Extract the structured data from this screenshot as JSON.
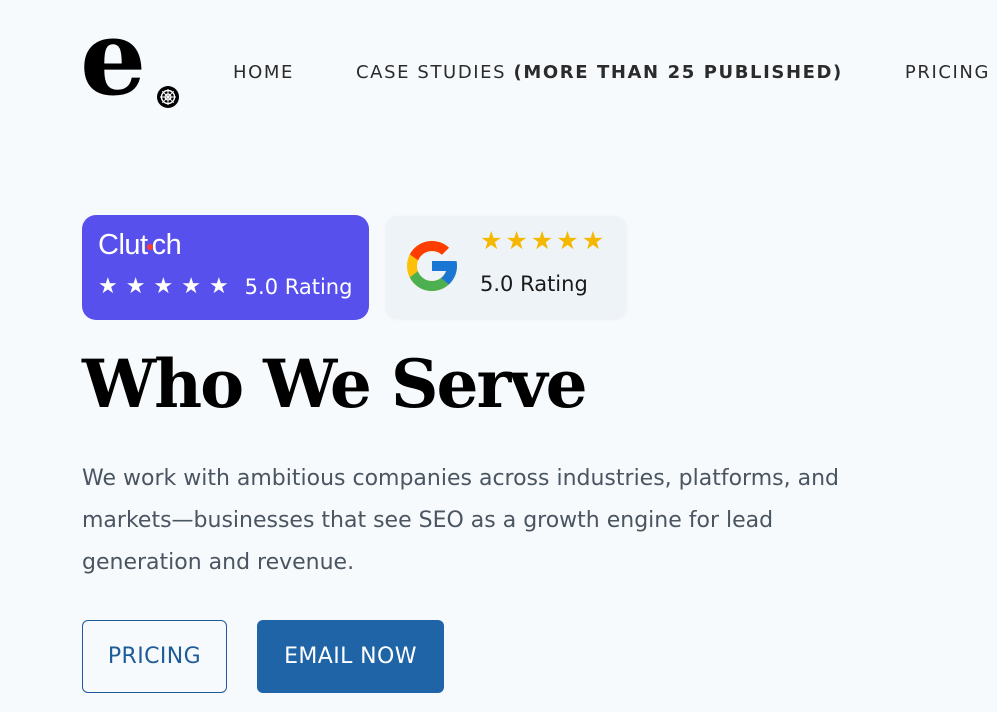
{
  "logo": {
    "letter": "e"
  },
  "nav": {
    "home": "HOME",
    "case_studies": "CASE STUDIES",
    "case_studies_highlight": "(MORE THAN 25 PUBLISHED)",
    "pricing": "PRICING"
  },
  "ratings": {
    "clutch": {
      "brand_prefix": "Clut",
      "brand_suffix": "ch",
      "stars": 5,
      "rating_label": "5.0 Rating",
      "color": "#5850ec",
      "dot_color": "#ff3d2e"
    },
    "google": {
      "stars": 5,
      "rating_label": "5.0 Rating",
      "star_color": "#f5b800",
      "icon": "google-g-icon"
    }
  },
  "hero": {
    "title": "Who We Serve",
    "description": "We work with ambitious companies across industries, platforms, and markets—businesses that see SEO as a growth engine for lead generation and revenue."
  },
  "buttons": {
    "pricing": "PRICING",
    "email": "EMAIL NOW",
    "accent": "#1f64a6"
  }
}
